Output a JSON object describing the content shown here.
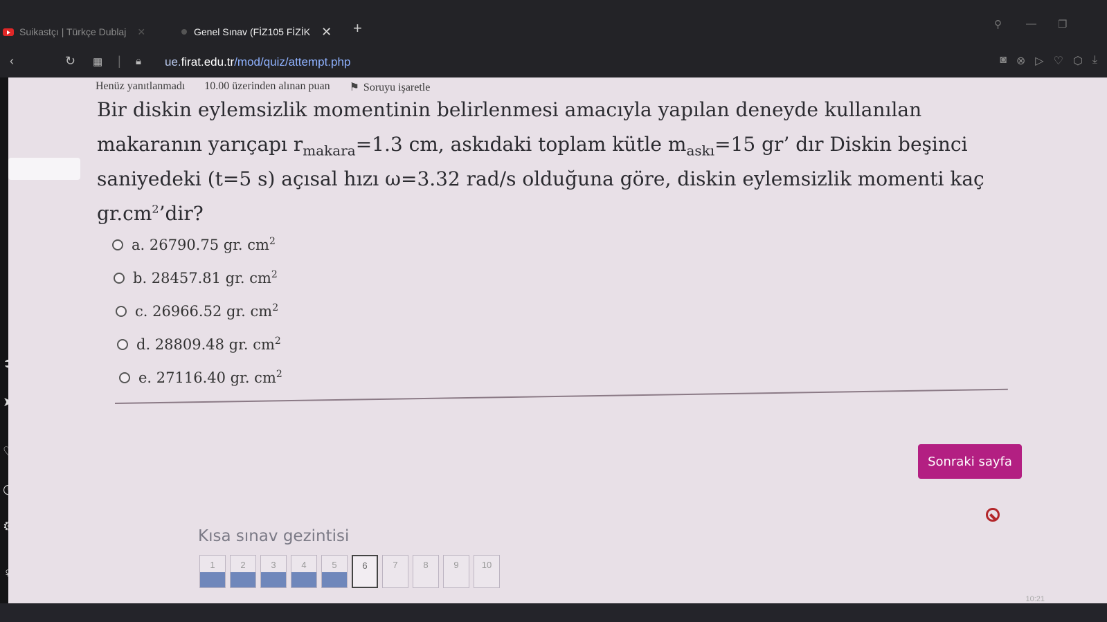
{
  "browser": {
    "tabs": [
      {
        "label": "Suikastçı | Türkçe Dublaj",
        "active": false
      },
      {
        "label": "Genel Sınav (FİZ105 FİZİK",
        "active": true
      }
    ],
    "new_tab": "+",
    "tab_close": "✕",
    "url": {
      "prefix": "ue.",
      "domain": "firat.edu.tr",
      "path": "/mod/quiz/attempt.php"
    }
  },
  "question": {
    "status": "Henüz yanıtlanmadı",
    "points": "10.00 üzerinden alınan puan",
    "flag_label": "Soruyu işaretle",
    "text": {
      "part1": "Bir diskin eylemsizlik momentinin belirlenmesi amacıyla yapılan deneyde kullanılan makaranın yarıçapı r",
      "sub1": "makara",
      "part2": "=1.3 cm, askıdaki toplam kütle m",
      "sub2": "askı",
      "part3": "=15 gr’ dır Diskin beşinci saniyedeki (t=5 s) açısal hızı ω=3.32 rad/s olduğuna göre, diskin eylemsizlik momenti kaç gr.cm",
      "sup": "2",
      "part4": "’dir?"
    },
    "options": [
      {
        "text": "a. 26790.75 gr. cm",
        "sup": "2"
      },
      {
        "text": "b. 28457.81 gr. cm",
        "sup": "2"
      },
      {
        "text": "c. 26966.52 gr. cm",
        "sup": "2"
      },
      {
        "text": "d. 28809.48 gr. cm",
        "sup": "2"
      },
      {
        "text": "e. 27116.40 gr. cm",
        "sup": "2"
      }
    ]
  },
  "next_button": "Sonraki sayfa",
  "quiz_navigation": {
    "title": "Kısa sınav gezintisi",
    "buttons": [
      "1",
      "2",
      "3",
      "4",
      "5",
      "6",
      "7",
      "8",
      "9",
      "10"
    ]
  },
  "taskbar": {
    "clock": "10:21"
  },
  "colors": {
    "accent": "#b31f82",
    "page_bg": "#e8e0e7",
    "answered": "#6f87bb"
  }
}
